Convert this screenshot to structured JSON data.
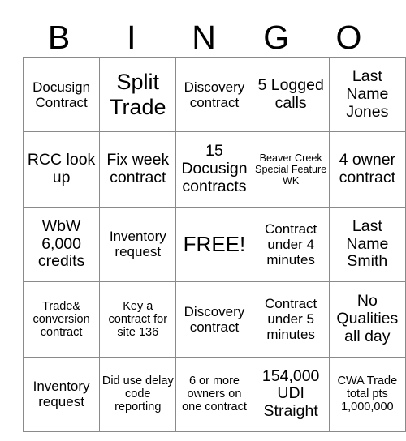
{
  "card": {
    "header_letters": [
      "B",
      "I",
      "N",
      "G",
      "O"
    ],
    "rows": [
      [
        {
          "text": "Docusign Contract",
          "size": "sm"
        },
        {
          "text": "Split Trade",
          "size": "xl"
        },
        {
          "text": "Discovery contract",
          "size": "sm"
        },
        {
          "text": "5 Logged calls",
          "size": "md"
        },
        {
          "text": "Last Name Jones",
          "size": "md"
        }
      ],
      [
        {
          "text": "RCC look up",
          "size": "md"
        },
        {
          "text": "Fix week contract",
          "size": "md"
        },
        {
          "text": "15 Docusign contracts",
          "size": "md"
        },
        {
          "text": "Beaver Creek Special Feature WK",
          "size": "xxs"
        },
        {
          "text": "4 owner contract",
          "size": "md"
        }
      ],
      [
        {
          "text": "WbW 6,000 credits",
          "size": "md"
        },
        {
          "text": "Inventory request",
          "size": "sm"
        },
        {
          "text": "FREE!",
          "size": "lg"
        },
        {
          "text": "Contract under 4 minutes",
          "size": "sm"
        },
        {
          "text": "Last Name Smith",
          "size": "md"
        }
      ],
      [
        {
          "text": "Trade& conversion contract",
          "size": "xs"
        },
        {
          "text": "Key a contract for site 136",
          "size": "xs"
        },
        {
          "text": "Discovery contract",
          "size": "sm"
        },
        {
          "text": "Contract under 5 minutes",
          "size": "sm"
        },
        {
          "text": "No Qualities all day",
          "size": "md"
        }
      ],
      [
        {
          "text": "Inventory request",
          "size": "sm"
        },
        {
          "text": "Did use delay code reporting",
          "size": "xs"
        },
        {
          "text": "6 or more owners on one contract",
          "size": "xs"
        },
        {
          "text": "154,000 UDI Straight",
          "size": "md"
        },
        {
          "text": "CWA Trade total pts 1,000,000",
          "size": "xs"
        }
      ]
    ]
  },
  "colors": {
    "border": "#8a8a8a",
    "text": "#000000",
    "background": "#ffffff"
  }
}
